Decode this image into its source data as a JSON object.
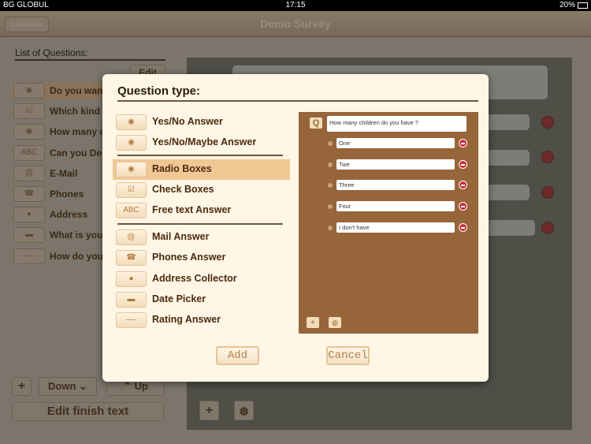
{
  "status_bar": {
    "carrier": "BG GLOBUL",
    "time": "17:15",
    "battery": "20%"
  },
  "nav": {
    "back_label": "Edit Mode",
    "title": "Demo Survey"
  },
  "sidebar": {
    "title": "List of Questions:",
    "edit_label": "Edit",
    "questions": [
      {
        "icon": "radio-icon",
        "label": "Do you want"
      },
      {
        "icon": "checkbox-icon",
        "label": "Which kind"
      },
      {
        "icon": "radio-icon",
        "label": "How many c"
      },
      {
        "icon": "abc-icon",
        "label": "Can you Des"
      },
      {
        "icon": "at-icon",
        "label": "E-Mail"
      },
      {
        "icon": "phone-icon",
        "label": "Phones"
      },
      {
        "icon": "pin-icon",
        "label": "Address"
      },
      {
        "icon": "calendar-icon",
        "label": "What is your"
      },
      {
        "icon": "slider-icon",
        "label": "How do you"
      }
    ],
    "add_label": "+",
    "down_label": "Down",
    "up_label": "Up",
    "finish_label": "Edit finish text"
  },
  "modal": {
    "title": "Question type:",
    "groups": [
      [
        {
          "icon": "radio-icon",
          "label": "Yes/No Answer"
        },
        {
          "icon": "radio-icon",
          "label": "Yes/No/Maybe Answer"
        }
      ],
      [
        {
          "icon": "radio-icon",
          "label": "Radio Boxes",
          "selected": true
        },
        {
          "icon": "checkbox-icon",
          "label": "Check Boxes"
        },
        {
          "icon": "abc-icon",
          "label": "Free text Answer"
        }
      ],
      [
        {
          "icon": "at-icon",
          "label": "Mail Answer"
        },
        {
          "icon": "phone-icon",
          "label": "Phones Answer"
        },
        {
          "icon": "pin-icon",
          "label": "Address Collector"
        },
        {
          "icon": "calendar-icon",
          "label": "Date Picker"
        },
        {
          "icon": "slider-icon",
          "label": "Rating Answer"
        }
      ]
    ],
    "preview": {
      "q_icon": "Q",
      "question": "How many children do you have ?",
      "options": [
        "One",
        "Twe",
        "Three",
        "Four",
        "I don't have"
      ]
    },
    "add_label": "Add",
    "cancel_label": "Cancel"
  },
  "colors": {
    "modal_bg": "#fff6e5",
    "preview_bg": "#97653a",
    "selected": "#f0c894",
    "remove": "#c8303a"
  }
}
